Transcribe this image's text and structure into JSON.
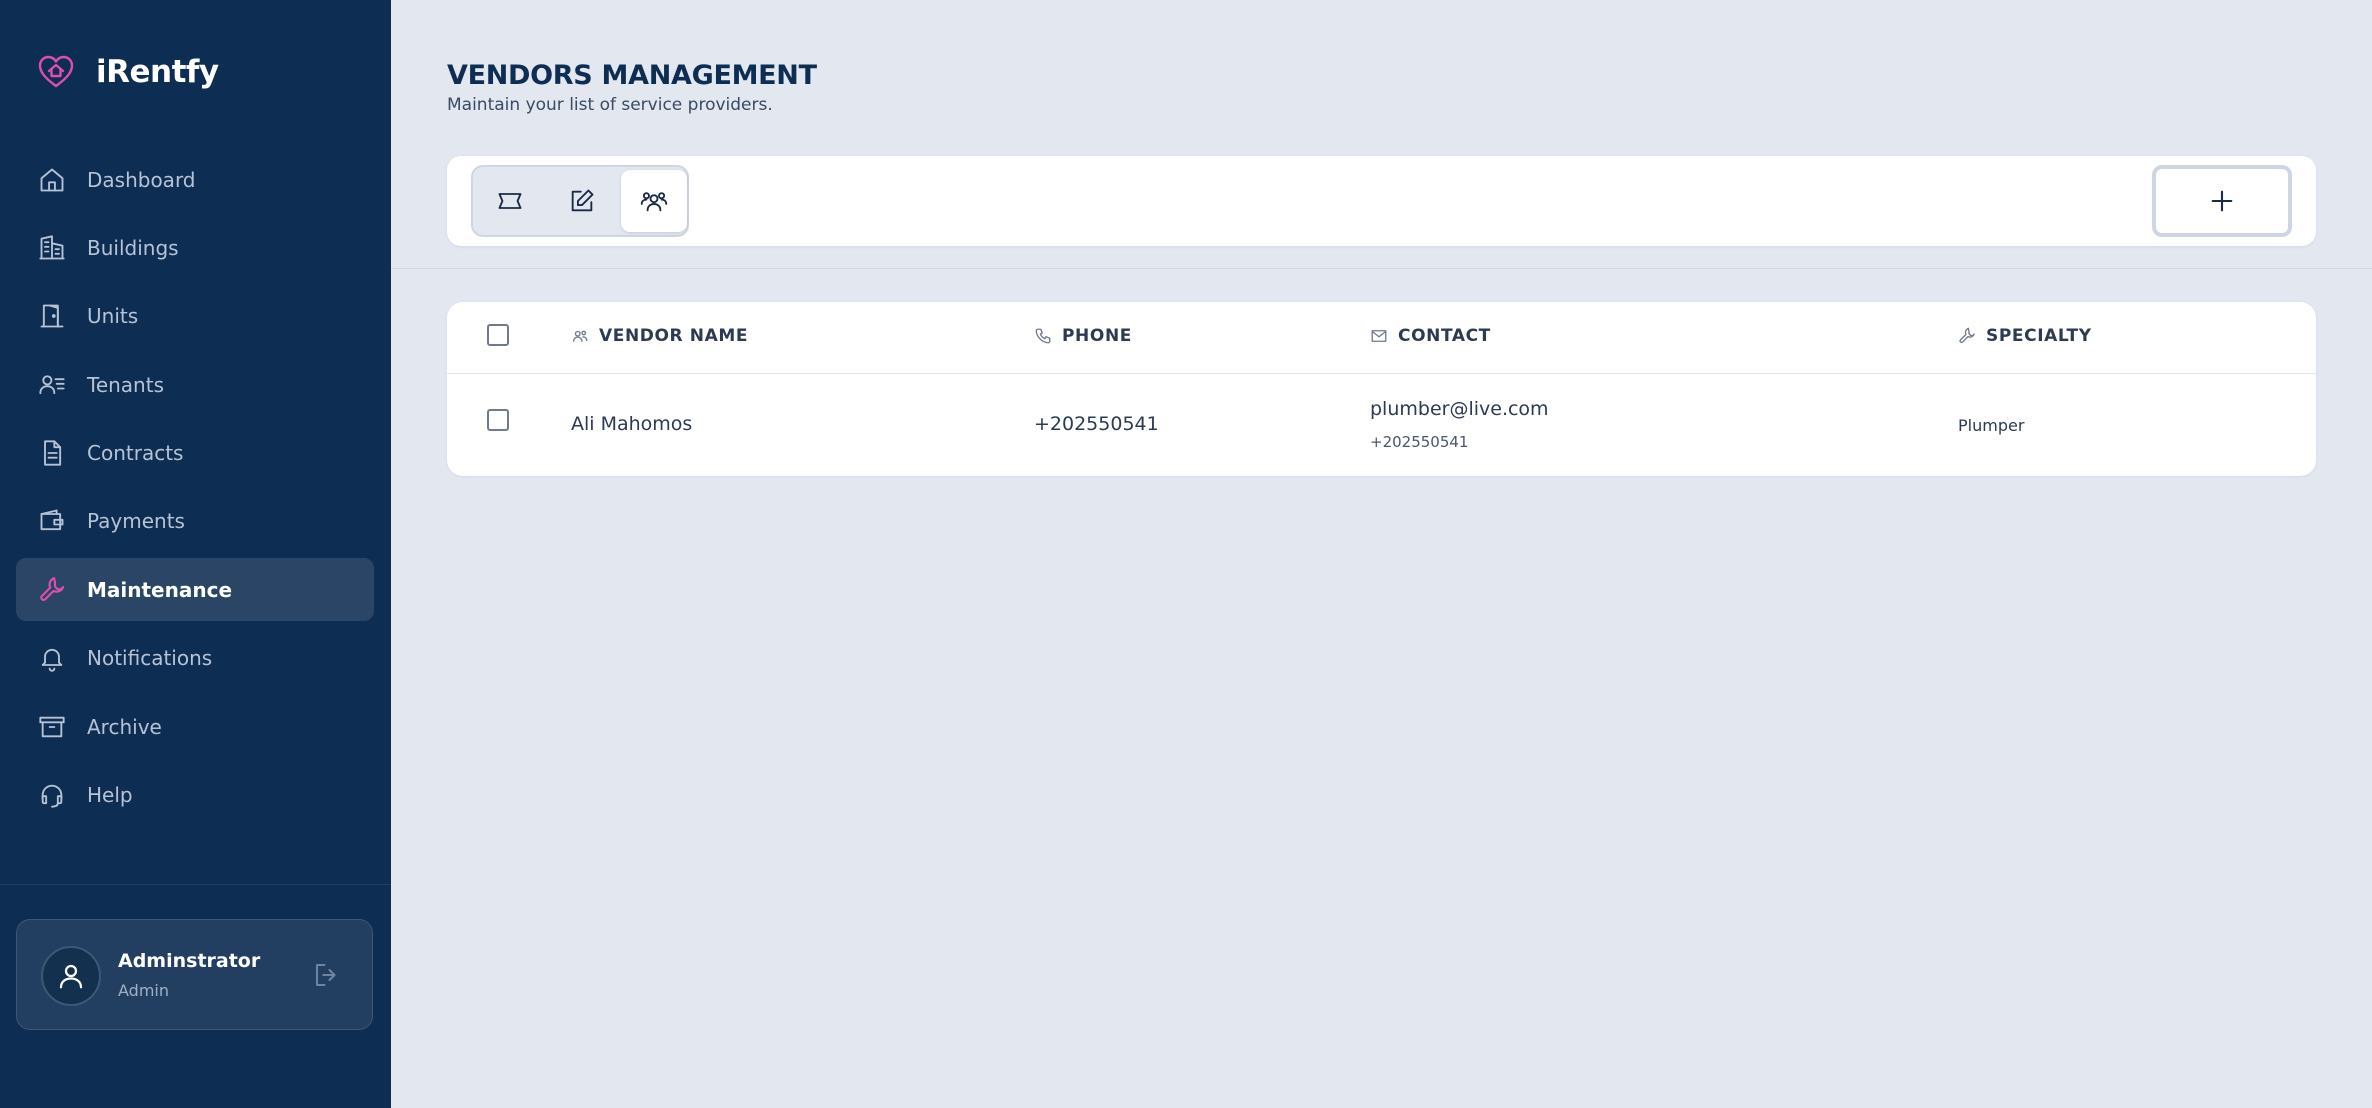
{
  "brand": {
    "name": "iRentfy",
    "accent": "#e04fae"
  },
  "sidebar": {
    "items": [
      {
        "label": "Dashboard",
        "icon": "home-icon"
      },
      {
        "label": "Buildings",
        "icon": "buildings-icon"
      },
      {
        "label": "Units",
        "icon": "door-icon"
      },
      {
        "label": "Tenants",
        "icon": "user-list-icon"
      },
      {
        "label": "Contracts",
        "icon": "document-icon"
      },
      {
        "label": "Payments",
        "icon": "wallet-icon"
      },
      {
        "label": "Maintenance",
        "icon": "wrench-icon",
        "active": true
      },
      {
        "label": "Notifications",
        "icon": "bell-icon"
      },
      {
        "label": "Archive",
        "icon": "archive-icon"
      },
      {
        "label": "Help",
        "icon": "headset-icon"
      }
    ]
  },
  "user": {
    "name": "Adminstrator",
    "role": "Admin"
  },
  "page": {
    "title": "VENDORS MANAGEMENT",
    "subtitle": "Maintain your list of service providers."
  },
  "toolbar": {
    "views": [
      {
        "icon": "ticket-icon"
      },
      {
        "icon": "edit-icon"
      },
      {
        "icon": "users-icon",
        "active": true
      }
    ],
    "add_icon": "plus-icon"
  },
  "table": {
    "columns": {
      "vendor_name": "VENDOR NAME",
      "phone": "PHONE",
      "contact": "CONTACT",
      "specialty": "SPECIALTY"
    },
    "rows": [
      {
        "vendor_name": "Ali Mahomos",
        "phone": "+202550541",
        "contact_email": "plumber@live.com",
        "contact_phone": "+202550541",
        "specialty": "Plumper"
      }
    ]
  }
}
